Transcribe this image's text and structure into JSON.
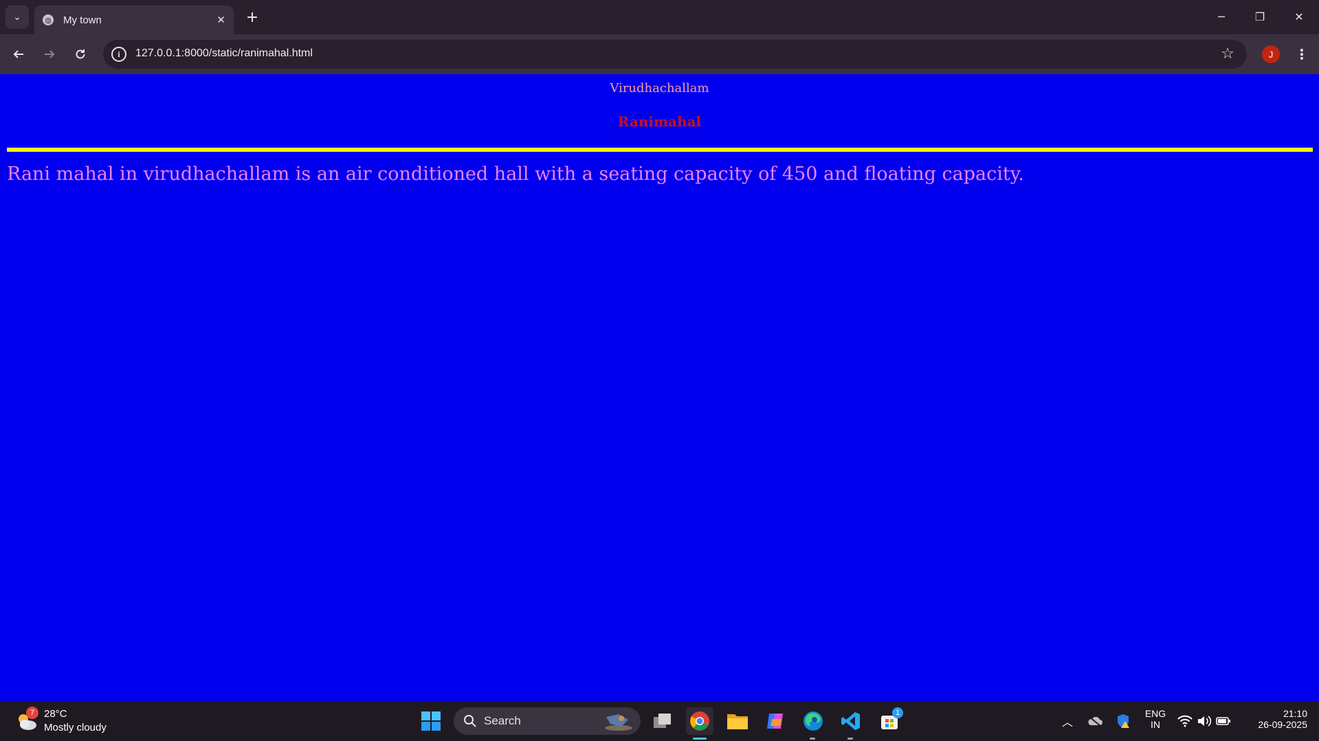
{
  "browser": {
    "tab_title": "My town",
    "url": "127.0.0.1:8000/static/ranimahal.html",
    "profile_initial": "J",
    "window_controls": {
      "minimize": "─",
      "restore": "❐",
      "close": "✕"
    }
  },
  "page": {
    "town": "Virudhachallam",
    "hall": "Ranimahal",
    "description": "Rani mahal in virudhachallam is an air conditioned hall with a seating capacity of 450 and floating capacity."
  },
  "taskbar": {
    "weather_temp": "28°C",
    "weather_desc": "Mostly cloudy",
    "weather_badge": "7",
    "search_label": "Search",
    "store_badge": "1",
    "lang_top": "ENG",
    "lang_bottom": "IN",
    "time": "21:10",
    "date": "26-09-2025"
  },
  "colors": {
    "page_bg": "#0000ee",
    "town_text": "#ff9aa0",
    "hall_text": "#cc1010",
    "rule": "#ffff00",
    "desc_text": "#ee82ee"
  }
}
